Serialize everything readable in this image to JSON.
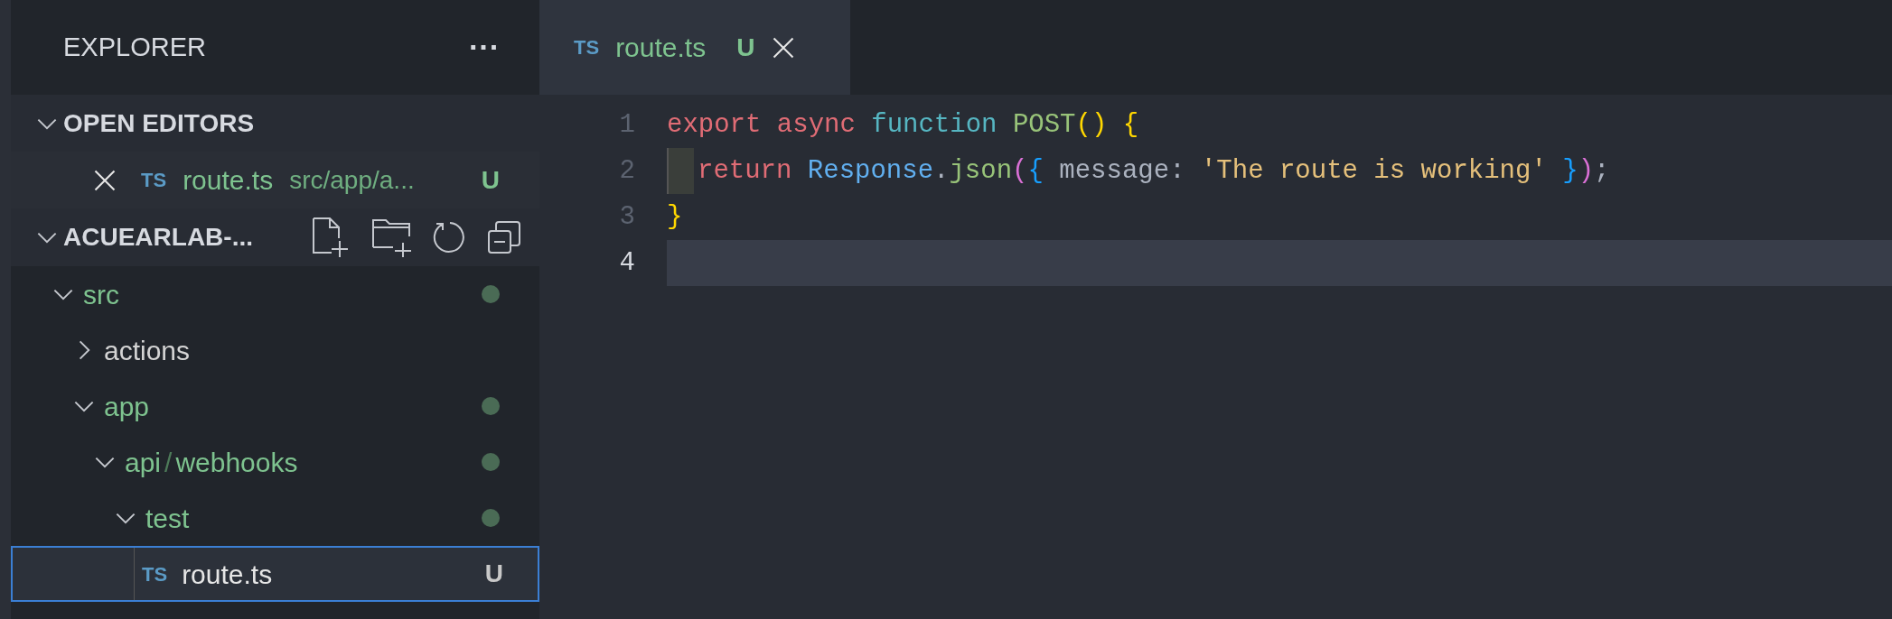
{
  "sidebar": {
    "title": "EXPLORER",
    "more": "···",
    "open_editors": {
      "title": "OPEN EDITORS",
      "expanded": true,
      "items": [
        {
          "icon_text": "TS",
          "name": "route.ts",
          "path": "src/app/a...",
          "badge": "U",
          "untracked": true
        }
      ]
    },
    "project": {
      "title": "ACUEARLAB-...",
      "expanded": true
    },
    "tree": [
      {
        "kind": "folder",
        "label": "src",
        "expanded": true,
        "untracked": true,
        "modified": true,
        "selected": false,
        "children": [
          {
            "kind": "folder",
            "label": "actions",
            "expanded": false,
            "untracked": false,
            "modified": false,
            "selected": false
          },
          {
            "kind": "folder",
            "label": "app",
            "expanded": true,
            "untracked": true,
            "modified": true,
            "selected": false,
            "children": [
              {
                "kind": "folder",
                "segments": [
                  "api",
                  "webhooks"
                ],
                "separator": "/",
                "expanded": true,
                "untracked": true,
                "modified": true,
                "selected": false,
                "children": [
                  {
                    "kind": "folder",
                    "label": "test",
                    "expanded": true,
                    "untracked": true,
                    "modified": true,
                    "selected": false,
                    "children": [
                      {
                        "kind": "file",
                        "icon_text": "TS",
                        "label": "route.ts",
                        "badge": "U",
                        "modified": false,
                        "selected": true
                      }
                    ]
                  }
                ]
              }
            ]
          }
        ]
      }
    ]
  },
  "tabs": [
    {
      "icon_text": "TS",
      "label": "route.ts",
      "badge": "U",
      "selected": true,
      "untracked": true
    }
  ],
  "code": [
    {
      "number": "1",
      "current": false,
      "tokens": [
        {
          "kind": "keyword",
          "text": "export "
        },
        {
          "kind": "keyword",
          "text": "async "
        },
        {
          "kind": "storage",
          "text": "function "
        },
        {
          "kind": "function",
          "text": "POST"
        },
        {
          "kind": "bracket1",
          "text": "() {"
        }
      ]
    },
    {
      "number": "2",
      "current": false,
      "indent": true,
      "tokens": [
        {
          "kind": "keyword",
          "text": "return "
        },
        {
          "kind": "class",
          "text": "Response"
        },
        {
          "kind": "plain",
          "text": "."
        },
        {
          "kind": "function",
          "text": "json"
        },
        {
          "kind": "bracket2",
          "text": "("
        },
        {
          "kind": "bracket3",
          "text": "{"
        },
        {
          "kind": "plain",
          "text": " message: "
        },
        {
          "kind": "string",
          "text": "'The route is working'"
        },
        {
          "kind": "bracket3",
          "text": " }"
        },
        {
          "kind": "bracket2",
          "text": ")"
        },
        {
          "kind": "plain",
          "text": ";"
        }
      ]
    },
    {
      "number": "3",
      "current": false,
      "tokens": [
        {
          "kind": "bracket1",
          "text": "}"
        }
      ]
    },
    {
      "number": "4",
      "current": true
    }
  ]
}
